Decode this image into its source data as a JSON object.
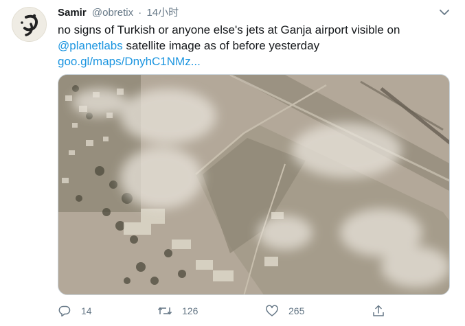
{
  "author": {
    "name": "Samir",
    "handle": "@obretix",
    "separator": "·",
    "time": "14小时"
  },
  "tweet": {
    "text_line1": "no signs of Turkish or anyone else's jets at Ganja airport visible on",
    "mention": "@planetlabs",
    "text_line2_rest": " satellite image as of before yesterday",
    "url": "goo.gl/maps/DnyhC1NMz..."
  },
  "media": {
    "alt": "satellite image of Ganja airport"
  },
  "actions": {
    "replies": "14",
    "retweets": "126",
    "likes": "265"
  },
  "icons": {
    "menu": "chevron-down-icon",
    "reply": "reply-icon",
    "retweet": "retweet-icon",
    "like": "heart-icon",
    "share": "share-icon"
  },
  "colors": {
    "link": "#1b95e0",
    "muted": "#657786",
    "text": "#14171a"
  }
}
